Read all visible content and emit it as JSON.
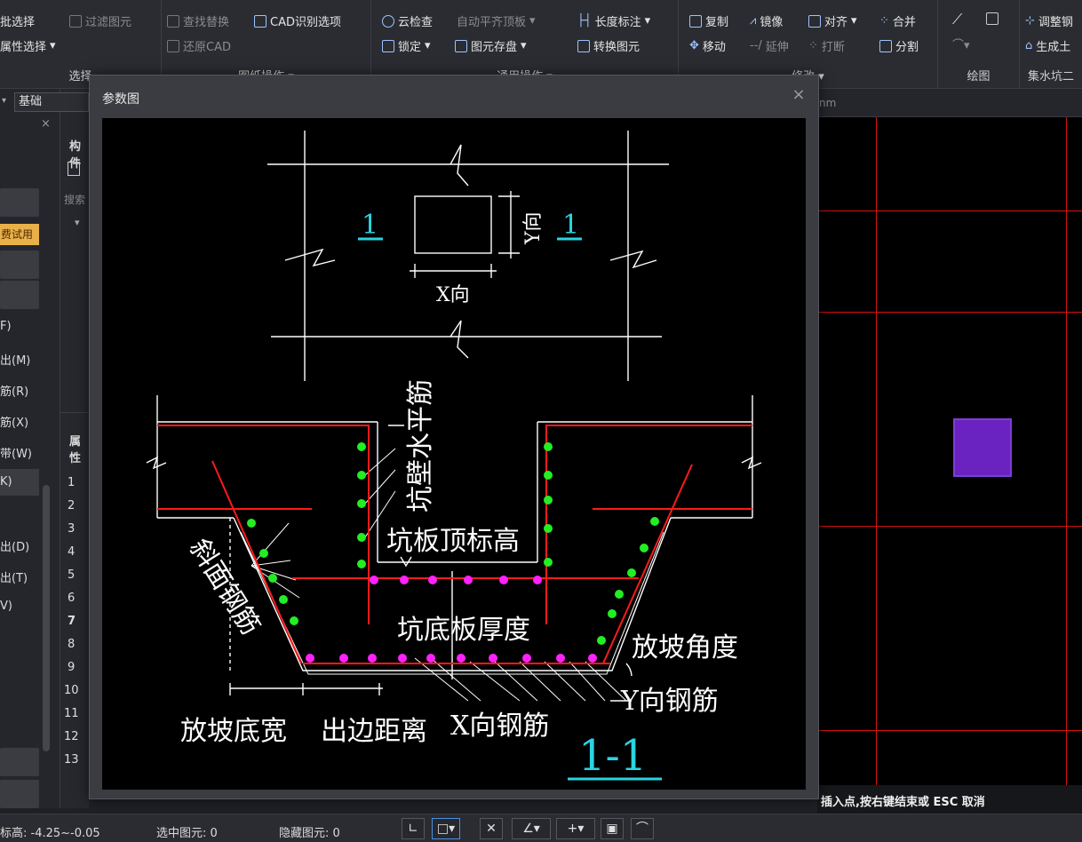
{
  "ribbon": {
    "groups": [
      {
        "title": "选择",
        "items": [
          "批选择",
          "属性选择"
        ]
      },
      {
        "title": "图纸操作",
        "items": [
          "查找替换",
          "CAD识别选项",
          "还原CAD",
          "过滤图元"
        ]
      },
      {
        "title": "通用操作",
        "items": [
          "云检查",
          "自动平齐顶板",
          "锁定",
          "图元存盘",
          "长度标注",
          "转换图元"
        ]
      },
      {
        "title": "修改",
        "items": [
          "复制",
          "镜像",
          "对齐",
          "合并",
          "移动",
          "延伸",
          "打断",
          "分割"
        ]
      },
      {
        "title": "绘图",
        "items": []
      },
      {
        "title": "集水坑二",
        "items": [
          "调整钢",
          "生成土"
        ]
      }
    ]
  },
  "left_panel": {
    "combo_value": "基础",
    "trial_badge": "费试用",
    "construct_header": "构件",
    "search_placeholder": "搜索",
    "props_header": "属性",
    "menu_items": [
      "F)",
      "出(M)",
      "筋(R)",
      "筋(X)",
      "带(W)",
      "K)",
      "出(D)",
      "出(T)",
      "V)"
    ],
    "row_numbers": [
      "1",
      "2",
      "3",
      "4",
      "5",
      "6",
      "7",
      "8",
      "9",
      "10",
      "11",
      "12",
      "13"
    ]
  },
  "canvas": {
    "tab_text": "nm",
    "command_prompt": "插入点,按右键结束或 ESC 取消",
    "purple_color": "#6a23c0"
  },
  "dialog": {
    "title": "参数图",
    "close_symbol": "×",
    "figure": {
      "plan_marks": [
        "1",
        "1"
      ],
      "plan_x_label": "X向",
      "plan_y_label": "Y向",
      "section_labels": {
        "wall_rebar": "坑壁水平筋",
        "top_elevation": "坑板顶标高",
        "bottom_thickness": "坑底板厚度",
        "slope_angle": "放坡角度",
        "slope_rebar": "斜面钢筋",
        "y_rebar": "Y向钢筋",
        "x_rebar": "X向钢筋",
        "slope_width": "放坡底宽",
        "edge_distance": "出边距离",
        "section_title": "1-1"
      },
      "colors": {
        "rebar_line": "#ff1a1a",
        "rebar_dot": "#22ee22",
        "bottom_dot": "#ff22ff",
        "mark": "#2ad4e0"
      }
    }
  },
  "statusbar": {
    "elevation_label": "标高:",
    "elevation_value": "-4.25~-0.05",
    "selected_label": "选中图元:",
    "selected_value": "0",
    "hidden_label": "隐藏图元:",
    "hidden_value": "0"
  }
}
